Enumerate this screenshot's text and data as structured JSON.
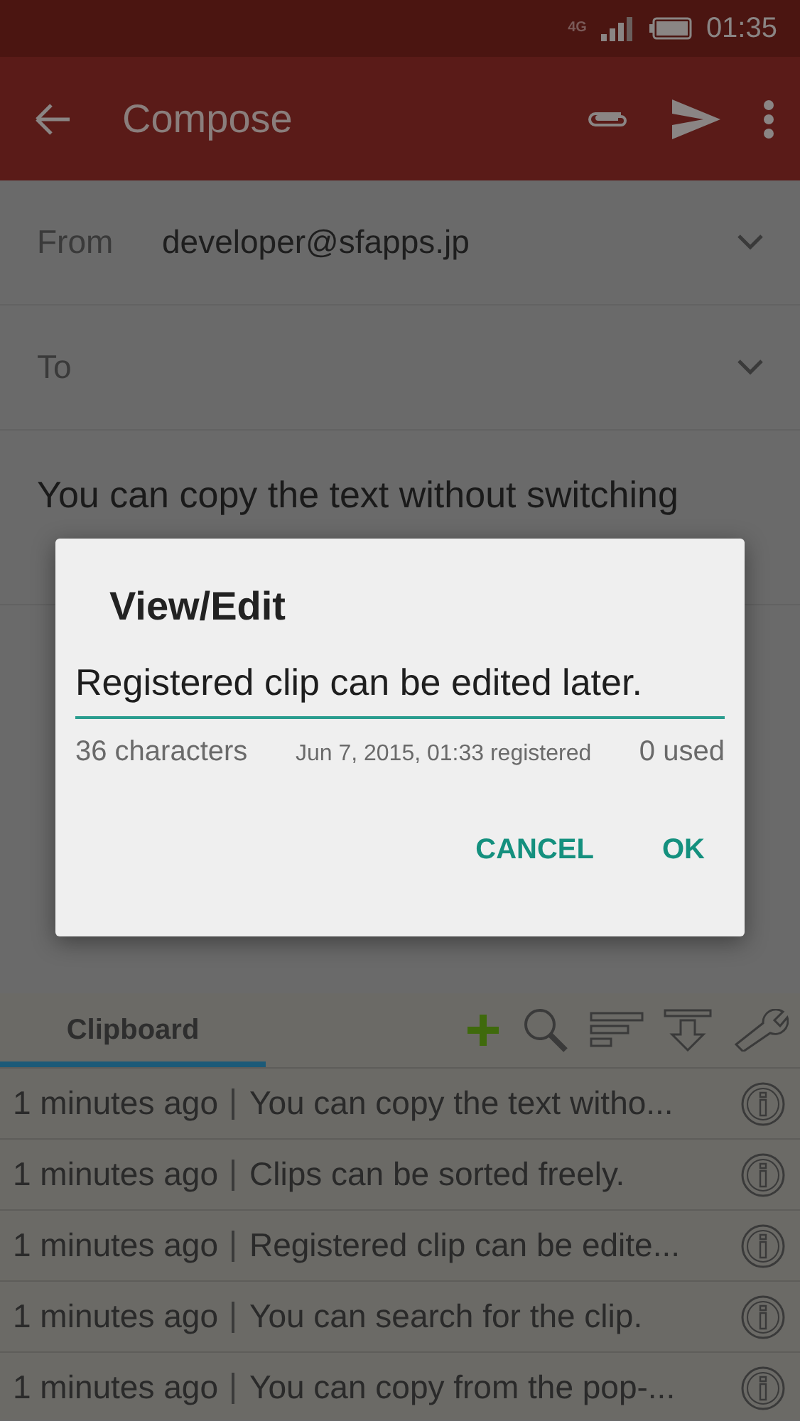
{
  "status_bar": {
    "network": "4G",
    "time": "01:35"
  },
  "app_bar": {
    "title": "Compose"
  },
  "form": {
    "from_label": "From",
    "from_value": "developer@sfapps.jp",
    "to_label": "To",
    "subject": "You can copy the text without switching"
  },
  "dialog": {
    "title": "View/Edit",
    "value": "Registered clip can be edited later.",
    "characters": "36 characters",
    "registered": "Jun 7, 2015, 01:33 registered",
    "used": "0 used",
    "buttons": [
      "CANCEL",
      "OK"
    ]
  },
  "clipboard": {
    "tabs": [
      {
        "label": "Clipboard",
        "selected": true
      }
    ],
    "clips": [
      {
        "time": "1 minutes ago",
        "text": "You can copy the text witho..."
      },
      {
        "time": "1 minutes ago",
        "text": "Clips can be sorted freely."
      },
      {
        "time": "1 minutes ago",
        "text": "Registered clip can be edite..."
      },
      {
        "time": "1 minutes ago",
        "text": "You can search for the clip."
      },
      {
        "time": "1 minutes ago",
        "text": "You can copy from the pop-..."
      }
    ]
  }
}
